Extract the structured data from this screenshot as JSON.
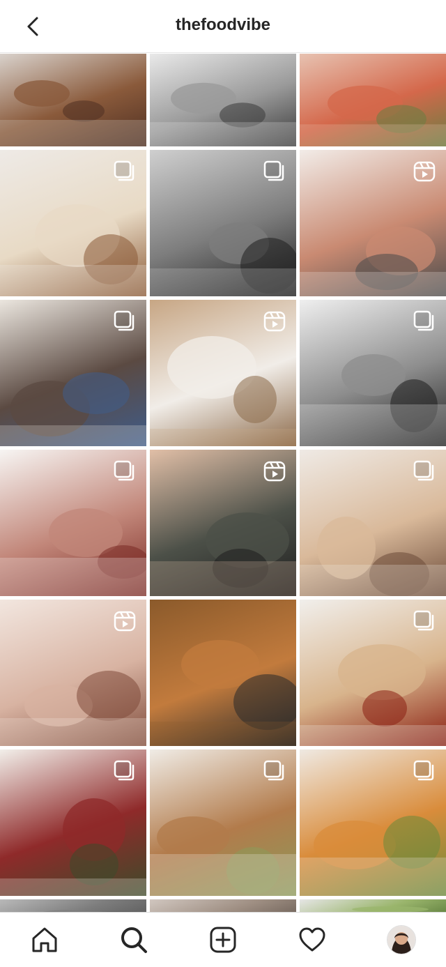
{
  "header": {
    "username": "thefoodvibe",
    "back_icon": "chevron-left-icon"
  },
  "grid": {
    "tiles": [
      {
        "name": "tile-brownies",
        "badge": "none",
        "colors": [
          "#d9d2cc",
          "#8a5a3b",
          "#4e2f22"
        ]
      },
      {
        "name": "tile-yoga-pose-1",
        "badge": "none",
        "colors": [
          "#e9e9e9",
          "#9a9a9a",
          "#3a3a3a"
        ]
      },
      {
        "name": "tile-tulips",
        "badge": "none",
        "colors": [
          "#e7c2b1",
          "#d4684b",
          "#6a7d42"
        ]
      },
      {
        "name": "tile-dessert-jar",
        "badge": "carousel",
        "colors": [
          "#eeeae6",
          "#e8dac5",
          "#8b5a36"
        ]
      },
      {
        "name": "tile-yoga-silhouette",
        "badge": "carousel",
        "colors": [
          "#cfcfcf",
          "#7d7d7d",
          "#1f1f1f"
        ]
      },
      {
        "name": "tile-yoga-headstand",
        "badge": "reel",
        "colors": [
          "#f2ece8",
          "#c98a72",
          "#4a4a4a"
        ]
      },
      {
        "name": "tile-camera-woman",
        "badge": "carousel",
        "colors": [
          "#ebe6df",
          "#5b4a42",
          "#3f5c8a"
        ]
      },
      {
        "name": "tile-candle",
        "badge": "reel",
        "colors": [
          "#c7a684",
          "#f1ede8",
          "#8d6b4b"
        ]
      },
      {
        "name": "tile-portrait-bw",
        "badge": "carousel",
        "colors": [
          "#efefef",
          "#8d8d8d",
          "#1d1d1d"
        ]
      },
      {
        "name": "tile-white-shirt",
        "badge": "carousel",
        "colors": [
          "#f7f5f3",
          "#c2877a",
          "#7a2a24"
        ]
      },
      {
        "name": "tile-sports-bra",
        "badge": "reel",
        "colors": [
          "#e1bfa7",
          "#4c5048",
          "#1e1e1e"
        ]
      },
      {
        "name": "tile-pear-bowl",
        "badge": "carousel",
        "colors": [
          "#efeae5",
          "#d9b99a",
          "#6b4a38"
        ]
      },
      {
        "name": "tile-painting-bowl",
        "badge": "reel",
        "colors": [
          "#f2e6df",
          "#d8b3a2",
          "#7f4b3a"
        ]
      },
      {
        "name": "tile-face-illustration",
        "badge": "none",
        "colors": [
          "#8b5a2b",
          "#c27b3d",
          "#2a2a2a"
        ]
      },
      {
        "name": "tile-pancakes",
        "badge": "carousel",
        "colors": [
          "#f1efec",
          "#d8b48c",
          "#8a1f12"
        ]
      },
      {
        "name": "tile-salad",
        "badge": "carousel",
        "colors": [
          "#f2efea",
          "#8f2a2a",
          "#3d4b2a"
        ]
      },
      {
        "name": "tile-wrap",
        "badge": "carousel",
        "colors": [
          "#f0ece6",
          "#b27b4b",
          "#8c9a5a"
        ]
      },
      {
        "name": "tile-soup",
        "badge": "carousel",
        "colors": [
          "#efe9e2",
          "#d98c3b",
          "#6a8a3a"
        ]
      },
      {
        "name": "tile-partial-1",
        "badge": "none",
        "colors": [
          "#b9b9b9",
          "#7d7d7d",
          "#5a5a5a"
        ]
      },
      {
        "name": "tile-partial-2",
        "badge": "none",
        "colors": [
          "#d1c7c0",
          "#9f8f83",
          "#6c5f56"
        ]
      },
      {
        "name": "tile-partial-3",
        "badge": "none",
        "colors": [
          "#e6e6e6",
          "#9ab56c",
          "#5a7a3a"
        ]
      }
    ]
  },
  "tabbar": {
    "items": [
      {
        "name": "tab-home",
        "icon": "home-icon"
      },
      {
        "name": "tab-search",
        "icon": "search-icon"
      },
      {
        "name": "tab-create",
        "icon": "add-post-icon"
      },
      {
        "name": "tab-activity",
        "icon": "heart-icon"
      },
      {
        "name": "tab-profile",
        "icon": "avatar"
      }
    ]
  }
}
